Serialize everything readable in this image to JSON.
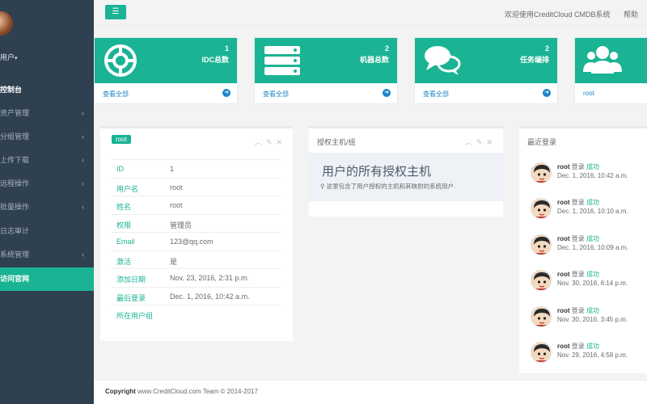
{
  "sidebar": {
    "user_label": "用户",
    "items": [
      {
        "label": "控制台",
        "chevron": false
      },
      {
        "label": "资产管理",
        "chevron": true
      },
      {
        "label": "分组管理",
        "chevron": true
      },
      {
        "label": "上传下载",
        "chevron": true
      },
      {
        "label": "远程操作",
        "chevron": true
      },
      {
        "label": "批量操作",
        "chevron": true
      },
      {
        "label": "日志审计",
        "chevron": false
      },
      {
        "label": "系统管理",
        "chevron": true
      },
      {
        "label": "访问官网",
        "chevron": false
      }
    ]
  },
  "topbar": {
    "menu_icon": "☰",
    "welcome": "欢迎使用CreditCloud CMDB系统",
    "help": "帮助"
  },
  "stats": [
    {
      "count": "1",
      "label": "IDC总数",
      "link": "查看全部",
      "icon": "lifebuoy-icon"
    },
    {
      "count": "2",
      "label": "机器总数",
      "link": "查看全部",
      "icon": "server-icon"
    },
    {
      "count": "2",
      "label": "任务编排",
      "link": "查看全部",
      "icon": "chat-icon"
    },
    {
      "count": "",
      "label": "",
      "link": "root",
      "icon": "users-icon"
    }
  ],
  "user_panel": {
    "badge": "root",
    "rows": [
      {
        "k": "ID",
        "v": "1"
      },
      {
        "k": "用户名",
        "v": "root"
      },
      {
        "k": "姓名",
        "v": "root"
      },
      {
        "k": "权限",
        "v": "管理员"
      },
      {
        "k": "Email",
        "v": "123@qq.com"
      },
      {
        "k": "激活",
        "v": "是"
      },
      {
        "k": "添加日期",
        "v": "Nov. 23, 2016, 2:31 p.m."
      },
      {
        "k": "最后登录",
        "v": "Dec. 1, 2016, 10:42 a.m."
      },
      {
        "k": "所在用户组",
        "v": ""
      }
    ]
  },
  "grant_panel": {
    "title": "授权主机/组",
    "heading": "用户的所有授权主机",
    "desc": "这里包含了用户授权的主机和其映射的系统用户."
  },
  "login_panel": {
    "title": "最近登录",
    "items": [
      {
        "user": "root",
        "action": "登录",
        "status": "成功",
        "time": "Dec. 1, 2016, 10:42 a.m."
      },
      {
        "user": "root",
        "action": "登录",
        "status": "成功",
        "time": "Dec. 1, 2016, 10:10 a.m."
      },
      {
        "user": "root",
        "action": "登录",
        "status": "成功",
        "time": "Dec. 1, 2016, 10:09 a.m."
      },
      {
        "user": "root",
        "action": "登录",
        "status": "成功",
        "time": "Nov. 30, 2016, 6:14 p.m."
      },
      {
        "user": "root",
        "action": "登录",
        "status": "成功",
        "time": "Nov. 30, 2016, 3:45 p.m."
      },
      {
        "user": "root",
        "action": "登录",
        "status": "成功",
        "time": "Nov. 29, 2016, 4:58 p.m."
      }
    ]
  },
  "footer": {
    "bold": "Copyright",
    "text": " www.CreditCloud.com Team © 2014-2017"
  },
  "colors": {
    "accent": "#1ab394",
    "sidebar": "#2f4050",
    "link": "#1c84c6"
  }
}
